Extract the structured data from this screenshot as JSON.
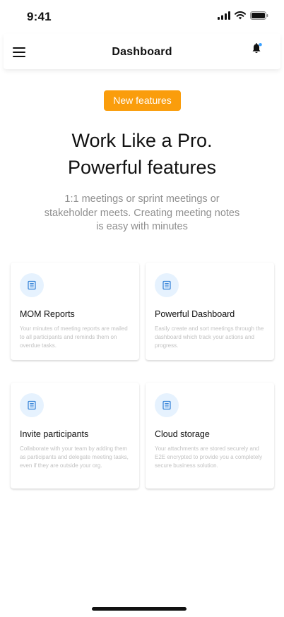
{
  "status_bar": {
    "time": "9:41"
  },
  "header": {
    "title": "Dashboard"
  },
  "hero": {
    "badge": "New features",
    "title_line1": "Work Like a Pro.",
    "title_line2": "Powerful features",
    "subtitle": "1:1 meetings or sprint meetings or stakeholder meets. Creating meeting notes is easy with minutes"
  },
  "features": [
    {
      "title": "MOM Reports",
      "description": "Your minutes of meeting reports are mailed to all participants and reminds them on overdue tasks.",
      "icon": "document-icon"
    },
    {
      "title": "Powerful Dashboard",
      "description": "Easily create and sort meetings through the dashboard which track your actions and progress.",
      "icon": "document-icon"
    },
    {
      "title": "Invite participants",
      "description": "Collaborate with your team by adding them as participants and delegate meeting tasks, even if they are outside your org.",
      "icon": "document-icon"
    },
    {
      "title": "Cloud storage",
      "description": "Your attachments are stored securely and E2E encrypted to provide you a completely secure business solution.",
      "icon": "document-icon"
    }
  ],
  "colors": {
    "accent": "#fa9d0c",
    "icon_bg": "#e6f2fe",
    "icon_stroke": "#2f7fd6",
    "notification_dot": "#3aa0ff"
  }
}
